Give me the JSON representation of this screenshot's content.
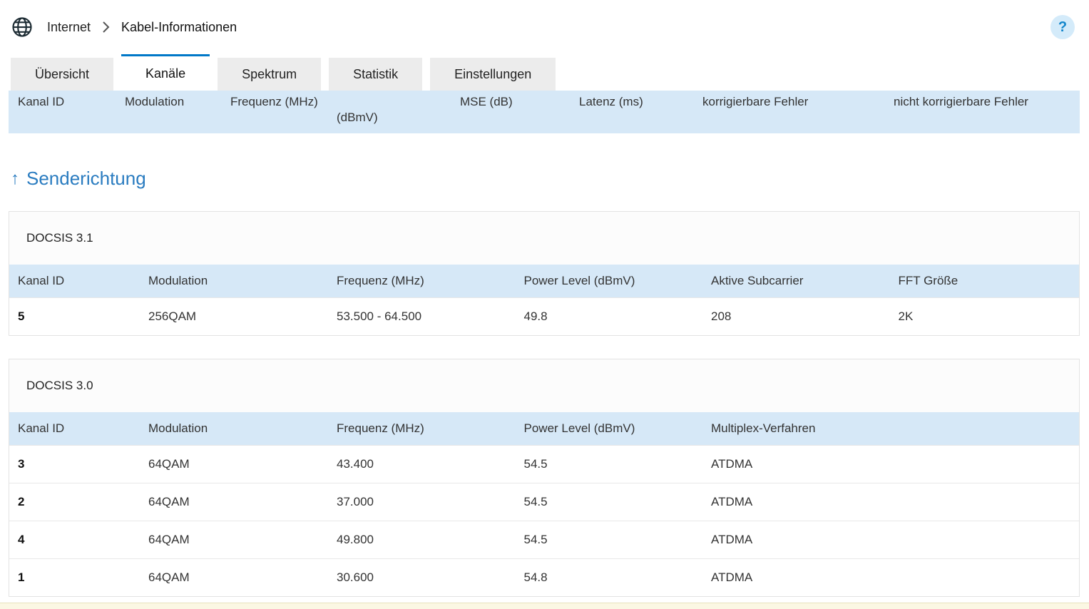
{
  "colors": {
    "accent_blue": "#0078c8",
    "table_header_bg": "#d6e8f7",
    "heading_blue": "#2a7cc0",
    "inactive_tab_bg": "#ececec"
  },
  "breadcrumb": {
    "section": "Internet",
    "page": "Kabel-Informationen"
  },
  "help": {
    "label": "?"
  },
  "tabs": [
    {
      "label": "Übersicht",
      "active": false
    },
    {
      "label": "Kanäle",
      "active": true
    },
    {
      "label": "Spektrum",
      "active": false
    },
    {
      "label": "Statistik",
      "active": false
    },
    {
      "label": "Einstellungen",
      "active": false
    }
  ],
  "clipped_table": {
    "headers": [
      "Kanal ID",
      "Modulation",
      "Frequenz (MHz)",
      "(dBmV)",
      "MSE (dB)",
      "Latenz (ms)",
      "korrigierbare Fehler",
      "nicht korrigierbare Fehler"
    ]
  },
  "section": {
    "arrow_icon": "↑",
    "title": "Senderichtung"
  },
  "tables": [
    {
      "group": "DOCSIS 3.1",
      "headers": [
        "Kanal ID",
        "Modulation",
        "Frequenz (MHz)",
        "Power Level (dBmV)",
        "Aktive Subcarrier",
        "FFT Größe"
      ],
      "rows": [
        [
          "5",
          "256QAM",
          "53.500 - 64.500",
          "49.8",
          "208",
          "2K"
        ]
      ]
    },
    {
      "group": "DOCSIS 3.0",
      "headers": [
        "Kanal ID",
        "Modulation",
        "Frequenz (MHz)",
        "Power Level (dBmV)",
        "Multiplex-Verfahren"
      ],
      "rows": [
        [
          "3",
          "64QAM",
          "43.400",
          "54.5",
          "ATDMA"
        ],
        [
          "2",
          "64QAM",
          "37.000",
          "54.5",
          "ATDMA"
        ],
        [
          "4",
          "64QAM",
          "49.800",
          "54.5",
          "ATDMA"
        ],
        [
          "1",
          "64QAM",
          "30.600",
          "54.8",
          "ATDMA"
        ]
      ]
    }
  ]
}
